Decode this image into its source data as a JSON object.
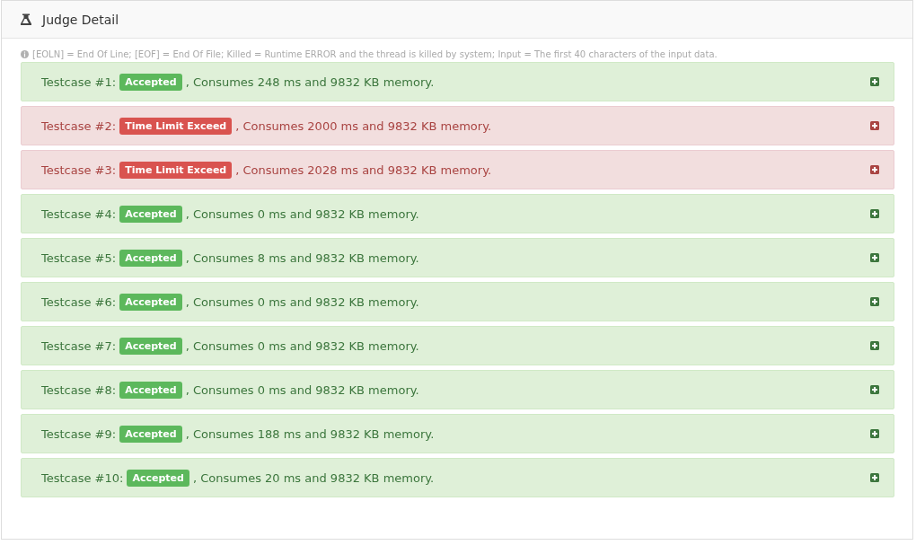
{
  "panel": {
    "title": "Judge Detail"
  },
  "legend": "[EOLN] = End Of Line; [EOF] = End Of File; Killed = Runtime ERROR and the thread is killed by system; Input = The first 40 characters of the input data.",
  "testcases": [
    {
      "label": "Testcase #1:",
      "kind": "accepted",
      "status": "Accepted",
      "detail": ", Consumes 248 ms and 9832 KB memory."
    },
    {
      "label": "Testcase #2:",
      "kind": "error",
      "status": "Time Limit Exceed",
      "detail": ", Consumes 2000 ms and 9832 KB memory."
    },
    {
      "label": "Testcase #3:",
      "kind": "error",
      "status": "Time Limit Exceed",
      "detail": ", Consumes 2028 ms and 9832 KB memory."
    },
    {
      "label": "Testcase #4:",
      "kind": "accepted",
      "status": "Accepted",
      "detail": ", Consumes 0 ms and 9832 KB memory."
    },
    {
      "label": "Testcase #5:",
      "kind": "accepted",
      "status": "Accepted",
      "detail": ", Consumes 8 ms and 9832 KB memory."
    },
    {
      "label": "Testcase #6:",
      "kind": "accepted",
      "status": "Accepted",
      "detail": ", Consumes 0 ms and 9832 KB memory."
    },
    {
      "label": "Testcase #7:",
      "kind": "accepted",
      "status": "Accepted",
      "detail": ", Consumes 0 ms and 9832 KB memory."
    },
    {
      "label": "Testcase #8:",
      "kind": "accepted",
      "status": "Accepted",
      "detail": ", Consumes 0 ms and 9832 KB memory."
    },
    {
      "label": "Testcase #9:",
      "kind": "accepted",
      "status": "Accepted",
      "detail": ", Consumes 188 ms and 9832 KB memory."
    },
    {
      "label": "Testcase #10:",
      "kind": "accepted",
      "status": "Accepted",
      "detail": ", Consumes 20 ms and 9832 KB memory."
    }
  ]
}
